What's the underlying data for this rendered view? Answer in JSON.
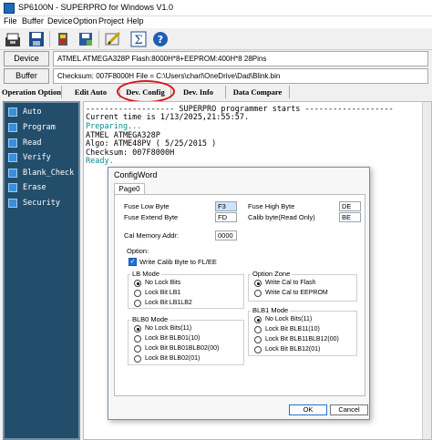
{
  "window": {
    "title": "SP6100N - SUPERPRO for Windows V1.0"
  },
  "menu": [
    "File",
    "Buffer",
    "Device",
    "Option",
    "Project",
    "Help"
  ],
  "toolbar": {
    "icons": [
      "load-file-icon",
      "save-file-icon",
      "select-device-icon",
      "save-project-icon",
      "edit-buffer-icon",
      "checksum-icon",
      "help-icon"
    ]
  },
  "device": {
    "button": "Device",
    "info": "ATMEL  ATMEGA328P  Flash:8000H*8+EEPROM:400H*8  28Pins"
  },
  "buffer": {
    "button": "Buffer",
    "info": "Checksum: 007F8000H    File = C:\\Users\\charl\\OneDrive\\Dad\\Blink.bin"
  },
  "tabs": [
    "Operation Option",
    "Edit Auto",
    "Dev. Config",
    "Dev. Info",
    "Data Compare"
  ],
  "sidebar": [
    "Auto",
    "Program",
    "Read",
    "Verify",
    "Blank_Check",
    "Erase",
    "Security"
  ],
  "log": {
    "lines": [
      {
        "text": "------------------- SUPERPRO programmer starts -------------------",
        "color": "#000000"
      },
      {
        "text": "Current time is 1/13/2025,21:55:57.",
        "color": "#000000"
      },
      {
        "text": "Preparing...",
        "color": "#0a8a8a"
      },
      {
        "text": "ATMEL ATMEGA328P",
        "color": "#000000"
      },
      {
        "text": "Algo: ATME48PV  ( 5/25/2015 )",
        "color": "#000000"
      },
      {
        "text": "Checksum: 007F8000H",
        "color": "#000000"
      },
      {
        "text": "Ready.",
        "color": "#0a8a8a"
      }
    ]
  },
  "dialog": {
    "title": "ConfigWord",
    "page_tab": "Page0",
    "fuse_low_label": "Fuse Low Byte",
    "fuse_low_value": "F3",
    "fuse_high_label": "Fuse High Byte",
    "fuse_high_value": "DE",
    "fuse_ext_label": "Fuse Extend Byte",
    "fuse_ext_value": "FD",
    "calib_label": "Calib byte(Read Only)",
    "calib_value": "BE",
    "cal_mem_label": "Cal Memory Addr:",
    "cal_mem_value": "0000",
    "option_title": "Option:",
    "write_calib_label": "Write Calib Byte to FL/EE",
    "write_calib_checked": true,
    "lb_mode": {
      "title": "LB Mode",
      "options": [
        "No Lock Bits",
        "Lock Bit LB1",
        "Lock Bit LB1LB2"
      ],
      "selected": 0
    },
    "option_zone": {
      "title": "Option Zone",
      "options": [
        "Write Cal to Flash",
        "Write Cal to EEPROM"
      ],
      "selected": 0
    },
    "blb0_mode": {
      "title": "BLB0 Mode",
      "options": [
        "No Lock Bits(11)",
        "Lock Bit BLB01(10)",
        "Lock Bit BLB01BLB02(00)",
        "Lock Bit BLB02(01)"
      ],
      "selected": 0
    },
    "blb1_mode": {
      "title": "BLB1 Mode",
      "options": [
        "No Lock Bits(11)",
        "Lock Bit BLB11(10)",
        "Lock Bit BLB11BLB12(00)",
        "Lock Bit BLB12(01)"
      ],
      "selected": 0
    },
    "ok_label": "OK",
    "cancel_label": "Cancel"
  },
  "colors": {
    "sidebar_bg": "#234e6b",
    "highlight_circle": "#d21a1a",
    "log_accent": "#0a8a8a"
  }
}
